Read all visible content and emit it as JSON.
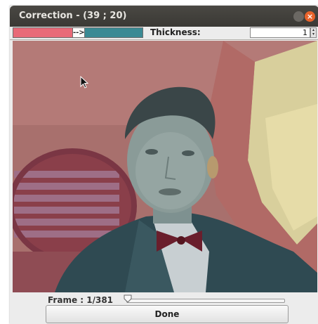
{
  "window": {
    "title": "Correction - (39 ; 20)",
    "close_glyph": "×"
  },
  "toolbar": {
    "from_color": "#e86a78",
    "arrow_label": "-->",
    "to_color": "#3a8a94",
    "thickness_label": "Thickness:",
    "thickness_value": "1",
    "spin_up_icon": "triangle-up",
    "spin_down_icon": "triangle-down"
  },
  "viewer": {
    "frame_label": "Frame : 1/381",
    "frame_position_fraction": 0.0,
    "done_label": "Done"
  }
}
